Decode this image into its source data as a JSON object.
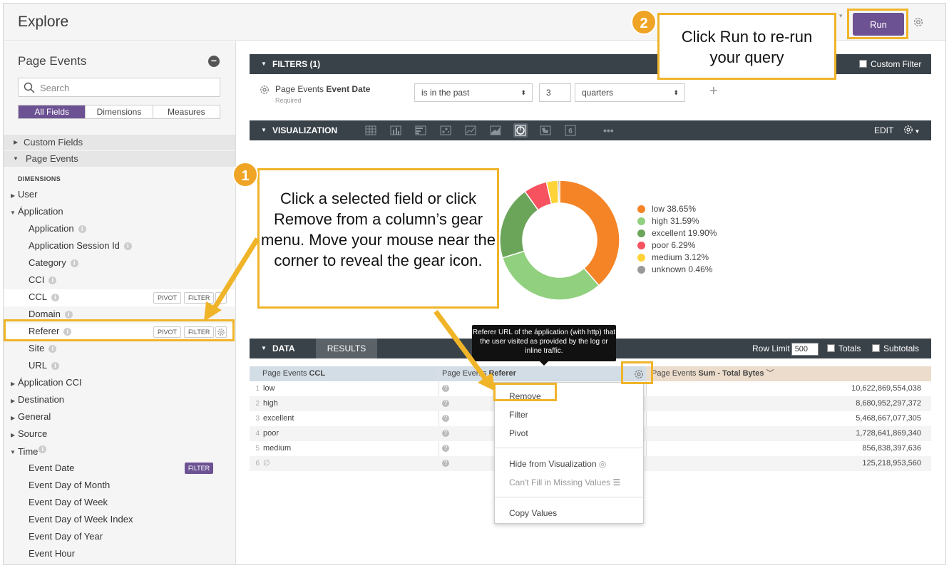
{
  "header": {
    "title": "Explore",
    "run_label": "Run"
  },
  "sidebar": {
    "title": "Page Events",
    "search_placeholder": "Search",
    "tabs": [
      "All Fields",
      "Dimensions",
      "Measures"
    ],
    "groups": {
      "custom_fields": "Custom Fields",
      "page_events": "Page Events"
    },
    "dimensions_heading": "DIMENSIONS",
    "items": {
      "user": "User",
      "application_group": "Ápplication",
      "application": "Application",
      "application_session_id": "Application Session Id",
      "category": "Category",
      "cci": "CCI",
      "ccl": "CCL",
      "domain": "Domain",
      "referer": "Referer",
      "site": "Site",
      "url": "URL",
      "application_cci": "Ápplication CCI",
      "destination": "Destination",
      "general": "General",
      "source": "Source",
      "time": "Time",
      "event_date": "Event Date",
      "event_day_of_month": "Event Day of Month",
      "event_day_of_week": "Event Day of Week",
      "event_day_of_week_index": "Event Day of Week Index",
      "event_day_of_year": "Event Day of Year",
      "event_hour": "Event Hour"
    },
    "pivot_label": "PIVOT",
    "filter_label": "FILTER",
    "event_date_tag": "FILTER"
  },
  "filters": {
    "bar_label": "FILTERS (1)",
    "custom_filter_label": "Custom Filter",
    "field_view": "Page Events",
    "field_name": "Event Date",
    "required": "Required",
    "operator": "is in the past",
    "value": "3",
    "unit": "quarters"
  },
  "visualization": {
    "bar_label": "VISUALIZATION",
    "edit_label": "EDIT",
    "more": "•••",
    "six_icon": "6"
  },
  "chart_data": {
    "type": "pie",
    "style": "donut",
    "slices": [
      {
        "label": "low",
        "pct_text": "38.65%",
        "value": 38.65,
        "color": "#f58426"
      },
      {
        "label": "high",
        "pct_text": "31.59%",
        "value": 31.59,
        "color": "#90d07e"
      },
      {
        "label": "excellent",
        "pct_text": "19.90%",
        "value": 19.9,
        "color": "#6ba55a"
      },
      {
        "label": "poor",
        "pct_text": "6.29%",
        "value": 6.29,
        "color": "#f7525f"
      },
      {
        "label": "medium",
        "pct_text": "3.12%",
        "value": 3.12,
        "color": "#fdd338"
      },
      {
        "label": "unknown",
        "pct_text": "0.46%",
        "value": 0.46,
        "color": "#999999"
      }
    ],
    "legend_position": "right"
  },
  "data": {
    "bar_label": "DATA",
    "results_tab": "RESULTS",
    "row_limit_label": "Row Limit",
    "row_limit_value": "500",
    "totals_label": "Totals",
    "subtotals_label": "Subtotals",
    "col1_view": "Page Events",
    "col1_name": "CCL",
    "col2_view": "Page Events",
    "col2_name": "Referer",
    "col3_view": "Page Events",
    "col3_name": "Sum - Total Bytes",
    "rows": [
      {
        "n": "1",
        "ccl": "low",
        "bytes": "10,622,869,554,038"
      },
      {
        "n": "2",
        "ccl": "high",
        "bytes": "8,680,952,297,372"
      },
      {
        "n": "3",
        "ccl": "excellent",
        "bytes": "5,468,667,077,305"
      },
      {
        "n": "4",
        "ccl": "poor",
        "bytes": "1,728,641,869,340"
      },
      {
        "n": "5",
        "ccl": "medium",
        "bytes": "856,838,397,636"
      },
      {
        "n": "6",
        "ccl": "∅",
        "bytes": "125,218,953,560"
      }
    ]
  },
  "tooltip": "Referer URL of the ápplication (with http) that the user visited as provided by the log or inline traffic.",
  "gear_menu": {
    "remove": "Remove",
    "filter": "Filter",
    "pivot": "Pivot",
    "hide": "Hide from Visualization",
    "cant_fill": "Can't Fill in Missing Values",
    "copy": "Copy Values"
  },
  "callouts": {
    "one_number": "1",
    "one_text": "Click a selected field or click Remove from a column’s gear menu. Move your mouse near the corner to reveal the gear icon.",
    "two_number": "2",
    "two_text": "Click Run to re-run your query"
  },
  "colors": {
    "accent": "#6c5293",
    "callout": "#f0b429",
    "bar": "#3a4249"
  }
}
